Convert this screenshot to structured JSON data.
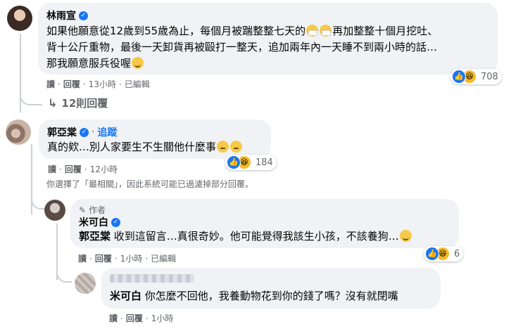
{
  "comment1": {
    "name": "林雨宣",
    "text_line1": "如果他願意從12歲到55歲為止，每個月被踹整整七天的",
    "text_line1_tail": "再加整整十個月挖吐、",
    "text_line2": "背十公斤重物，最後一天卸貨再被毆打一整天，追加兩年內一天睡不到兩小時的話…",
    "text_line3": "那我願意服兵役喔",
    "reaction_count": "708",
    "actions": {
      "read": "讀",
      "reply": "回覆",
      "time": "13小時",
      "edited": "已編輯"
    },
    "replies_link": "12則回覆"
  },
  "comment2": {
    "name": "郭亞棠",
    "follow": "追蹤",
    "text": "真的欸…別人家要生不生關他什麼事",
    "reaction_count": "184",
    "actions": {
      "read": "讀",
      "reply": "回覆",
      "time": "12小時"
    },
    "filter_note": "你選擇了「最相關」，因此系統可能已過濾掉部分回覆。"
  },
  "reply1": {
    "author_badge": "作者",
    "name": "米可白",
    "mention": "郭亞棠",
    "text": "收到這留言…真很奇妙。他可能覺得我該生小孩，不該養狗…",
    "reaction_count": "6",
    "actions": {
      "read": "讀",
      "reply": "回覆",
      "time": "1小時",
      "edited": "已編輯"
    }
  },
  "reply2": {
    "mention": "米可白",
    "text": "你怎麼不回他，我養動物花到你的錢了嗎？沒有就閉嘴",
    "actions": {
      "read": "讀",
      "reply": "回覆",
      "time": "1小時"
    }
  },
  "colors": {
    "accent": "#1877f2",
    "bubble": "#f0f2f5",
    "muted": "#65676b",
    "line": "#ccd0d5"
  }
}
